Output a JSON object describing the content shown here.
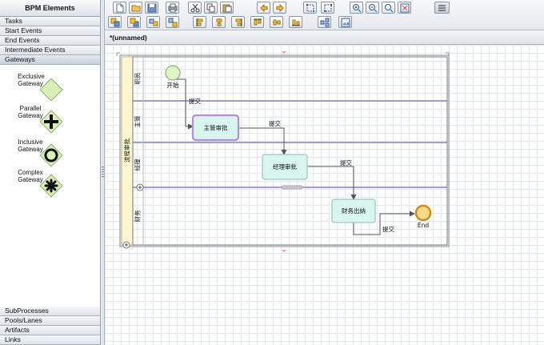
{
  "palette": {
    "title": "BPM Elements",
    "sections_top": [
      "Tasks",
      "Start Events",
      "End Events",
      "Intermediate Events",
      "Gateways"
    ],
    "gateways": [
      {
        "label_line1": "Exclusive",
        "label_line2": "Gateway",
        "icon": "exclusive-gateway-icon"
      },
      {
        "label_line1": "Parallel",
        "label_line2": "Gateway",
        "icon": "parallel-gateway-icon"
      },
      {
        "label_line1": "Inclusive",
        "label_line2": "Gateway",
        "icon": "inclusive-gateway-icon"
      },
      {
        "label_line1": "Complex",
        "label_line2": "Gateway",
        "icon": "complex-gateway-icon"
      }
    ],
    "sections_bottom": [
      "SubProcesses",
      "Pools/Lanes",
      "Artifacts",
      "Links"
    ]
  },
  "toolbar": {
    "row1": [
      "new-file-icon",
      "open-folder-icon",
      "save-icon",
      "print-icon",
      "cut-icon",
      "copy-icon",
      "paste-icon",
      "undo-icon",
      "redo-icon",
      "select-all-icon",
      "fit-selection-icon",
      "zoom-in-icon",
      "zoom-out-icon",
      "zoom-actual-icon",
      "zoom-fit-icon",
      "toggle-grid-icon"
    ],
    "row2": [
      "front-icon",
      "back-icon",
      "group-icon",
      "ungroup-icon",
      "align-left-icon",
      "align-center-icon",
      "align-right-icon",
      "align-top-icon",
      "align-middle-icon",
      "align-bottom-icon",
      "layout-icon",
      "export-image-icon"
    ]
  },
  "editor": {
    "tab_title": "*(unnamed)",
    "pool": {
      "name": "流程审批"
    },
    "lanes": [
      "职员",
      "主管",
      "经理",
      "财务"
    ],
    "nodes": {
      "start": "开始",
      "task1": "主管审批",
      "task2": "经理审批",
      "task3": "财务出纳",
      "end": "End"
    },
    "flows": [
      "提交",
      "提交",
      "提交",
      "提交"
    ],
    "colors": {
      "task_fill": "#d8f5ee",
      "task_border": "#8fbcb2",
      "task_selected_border": "#b38de0",
      "start_fill": "#dff5c8",
      "end_fill": "#f6d98a",
      "end_border": "#d08a1c",
      "gateway_fill": "#d8f0b8",
      "gateway_border": "#8fae74"
    }
  }
}
